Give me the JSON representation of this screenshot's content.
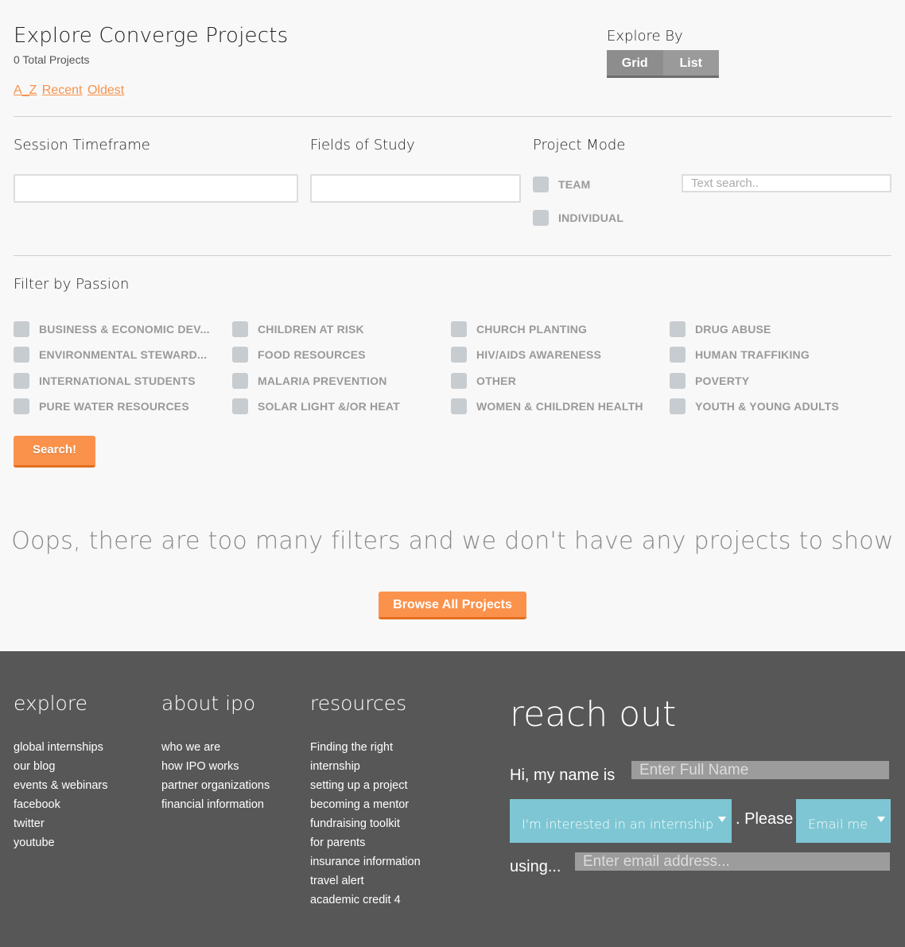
{
  "header": {
    "title": "Explore Converge Projects",
    "total": "0 Total Projects",
    "sort": [
      "A_Z",
      "Recent",
      "Oldest"
    ],
    "explore_by_label": "Explore By",
    "views": [
      "Grid",
      "List"
    ]
  },
  "filters": {
    "session_label": "Session Timeframe",
    "fields_label": "Fields of Study",
    "mode_label": "Project Mode",
    "modes": [
      "TEAM",
      "INDIVIDUAL"
    ],
    "text_search_placeholder": "Text search.."
  },
  "passion": {
    "label": "Filter by Passion",
    "items": [
      "BUSINESS & ECONOMIC DEV...",
      "CHILDREN AT RISK",
      "CHURCH PLANTING",
      "DRUG ABUSE",
      "ENVIRONMENTAL STEWARD...",
      "FOOD RESOURCES",
      "HIV/AIDS AWARENESS",
      "HUMAN TRAFFIKING",
      "INTERNATIONAL STUDENTS",
      "MALARIA PREVENTION",
      "OTHER",
      "POVERTY",
      "PURE WATER RESOURCES",
      "SOLAR LIGHT &/OR HEAT",
      "WOMEN & CHILDREN HEALTH",
      "YOUTH & YOUNG ADULTS"
    ],
    "search_button": "Search!"
  },
  "empty_state": {
    "message": "Oops, there are too many filters and we don't have any projects to show",
    "browse_button": "Browse All Projects"
  },
  "footer": {
    "explore": {
      "title": "explore",
      "links": [
        "global internships",
        "our blog",
        "events & webinars",
        "facebook",
        "twitter",
        "youtube"
      ]
    },
    "about": {
      "title": "about ipo",
      "links": [
        "who we are",
        "how IPO works",
        "partner organizations",
        "financial information"
      ]
    },
    "resources": {
      "title": "resources",
      "links": [
        "Finding the right",
        "internship",
        "setting up a project",
        "becoming a mentor",
        "fundraising toolkit",
        "for parents",
        "insurance information",
        "travel alert",
        "academic credit 4"
      ]
    },
    "reach_out": {
      "title": "reach out",
      "name_prefix": "Hi, my name is",
      "name_placeholder": "Enter Full Name",
      "interest_value": "I'm interested in an internship",
      "please_text": ". Please",
      "contact_value": "Email me",
      "using_text": "using...",
      "email_placeholder": "Enter email address..."
    }
  },
  "colors": {
    "accent": "#fb924b",
    "footer_bg": "#575757",
    "select_bg": "#7ec6d3"
  }
}
